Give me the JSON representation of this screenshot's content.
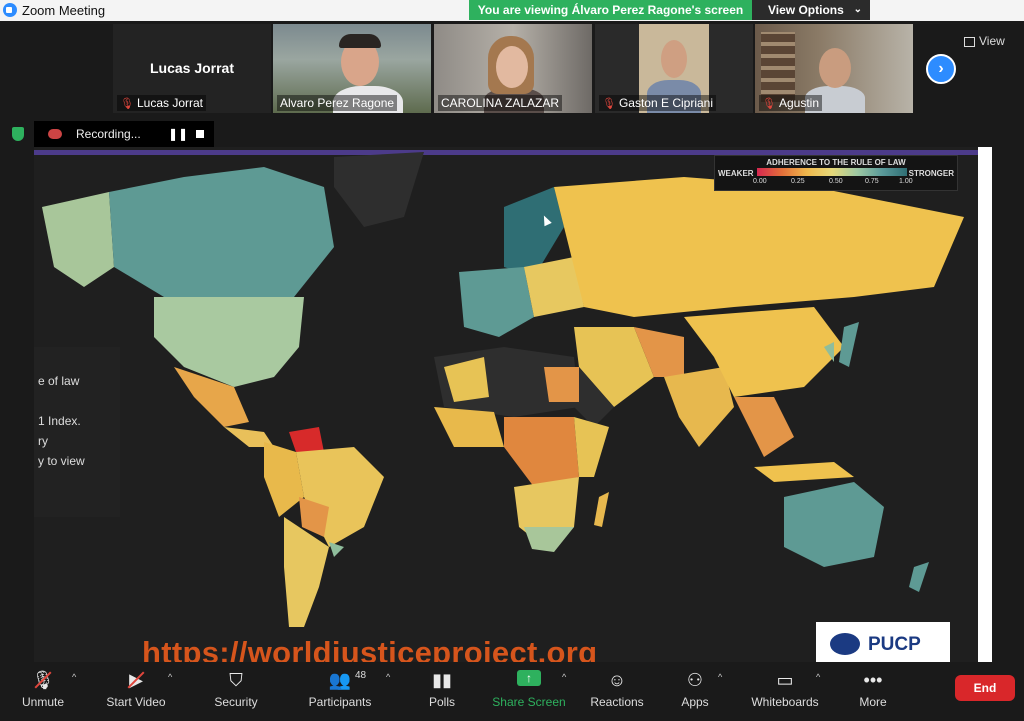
{
  "window": {
    "title": "Zoom Meeting"
  },
  "share_banner": {
    "text": "You are viewing Álvaro Perez Ragone's screen",
    "view_options": "View Options"
  },
  "participants": [
    {
      "name": "Lucas Jorrat",
      "display_name": "Lucas Jorrat",
      "muted": true,
      "video": false
    },
    {
      "name": "Alvaro Perez Ragone",
      "muted": false,
      "video": true
    },
    {
      "name": "CAROLINA ZALAZAR",
      "muted": false,
      "video": true
    },
    {
      "name": "Gaston E Cipriani",
      "muted": true,
      "video": true
    },
    {
      "name": "Agustin",
      "muted": true,
      "video": true
    }
  ],
  "view_button": "View",
  "recording": {
    "label": "Recording..."
  },
  "shared_slide": {
    "side_text": [
      "e of law",
      "1 Index.",
      "ry",
      "y to view"
    ],
    "legend": {
      "title": "ADHERENCE TO THE RULE OF LAW",
      "weaker": "WEAKER",
      "stronger": "STRONGER",
      "ticks": [
        "0.00",
        "0.25",
        "0.50",
        "0.75",
        "1.00"
      ]
    },
    "url": "https://worldjusticeproject.org",
    "logo_text": "PUCP"
  },
  "toolbar": {
    "unmute": "Unmute",
    "start_video": "Start Video",
    "security": "Security",
    "participants": "Participants",
    "participants_count": "48",
    "polls": "Polls",
    "share_screen": "Share Screen",
    "reactions": "Reactions",
    "apps": "Apps",
    "whiteboards": "Whiteboards",
    "more": "More",
    "end": "End"
  },
  "colors": {
    "accent_blue": "#2d8cff",
    "banner_green": "#2eb15e",
    "end_red": "#d9272a",
    "muted_red": "#e0463c"
  }
}
